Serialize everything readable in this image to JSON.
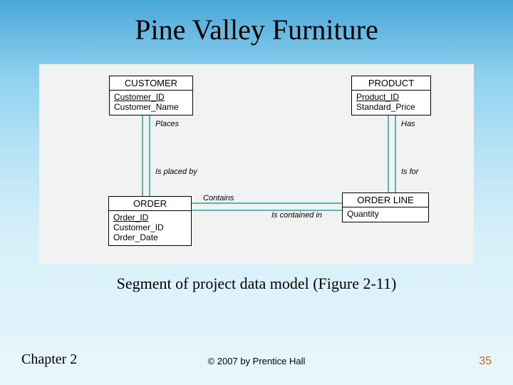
{
  "title": "Pine Valley Furniture",
  "caption": "Segment of project data model  (Figure 2-11)",
  "footer": {
    "left": "Chapter 2",
    "center": "© 2007 by Prentice Hall",
    "right": "35"
  },
  "entities": {
    "customer": {
      "name": "CUSTOMER",
      "pk": "Customer_ID",
      "attrs": [
        "Customer_Name"
      ]
    },
    "product": {
      "name": "PRODUCT",
      "pk": "Product_ID",
      "attrs": [
        "Standard_Price"
      ]
    },
    "order": {
      "name": "ORDER",
      "pk": "Order_ID",
      "attrs": [
        "Customer_ID",
        "Order_Date"
      ]
    },
    "order_line": {
      "name": "ORDER LINE",
      "pk": "",
      "attrs": [
        "Quantity"
      ]
    }
  },
  "relationships": {
    "places": "Places",
    "is_placed_by": "Is placed by",
    "contains": "Contains",
    "is_contained": "Is contained in",
    "has": "Has",
    "is_for": "Is for"
  }
}
